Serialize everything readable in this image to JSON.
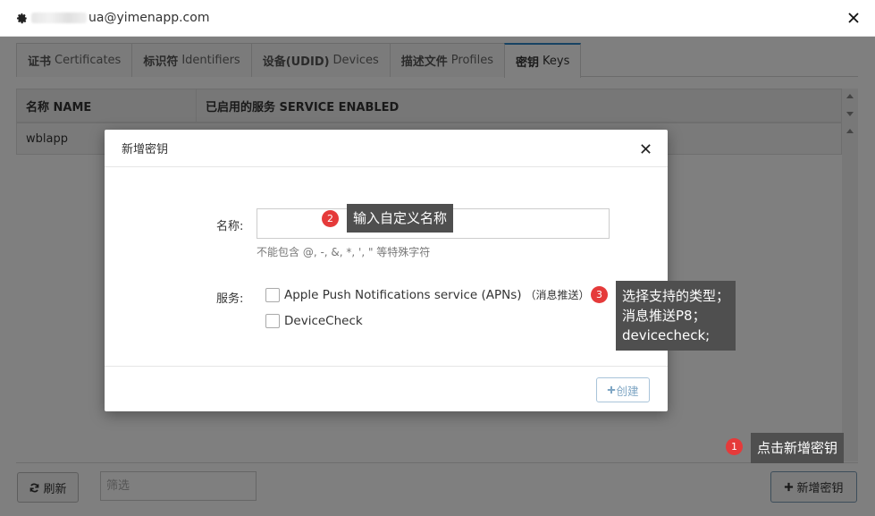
{
  "window": {
    "account": "ua@yimenapp.com"
  },
  "tabs": [
    {
      "zh": "证书",
      "en": "Certificates"
    },
    {
      "zh": "标识符",
      "en": "Identifiers"
    },
    {
      "zh": "设备(UDID)",
      "en": "Devices"
    },
    {
      "zh": "描述文件",
      "en": "Profiles"
    },
    {
      "zh": "密钥",
      "en": "Keys",
      "active": true
    }
  ],
  "table": {
    "columns": [
      "名称 NAME",
      "已启用的服务 SERVICE ENABLED"
    ],
    "rows": [
      {
        "name": "wblapp",
        "service": ""
      }
    ]
  },
  "toolbar": {
    "refresh_label": "刷新",
    "filter_placeholder": "筛选",
    "add_label": "新增密钥"
  },
  "modal": {
    "title": "新增密钥",
    "name_label": "名称:",
    "name_value": "",
    "name_hint": "不能包含 @, -, &, *, ', \" 等特殊字符",
    "service_label": "服务:",
    "services": [
      {
        "label": "Apple Push Notifications service (APNs)",
        "note": "（消息推送）",
        "checked": false
      },
      {
        "label": "DeviceCheck",
        "note": "",
        "checked": false
      }
    ],
    "create_label": "创建"
  },
  "annotations": [
    {
      "num": "1",
      "text": "点击新增密钥"
    },
    {
      "num": "2",
      "text": "输入自定义名称"
    },
    {
      "num": "3",
      "lines": [
        "选择支持的类型；",
        "消息推送P8；",
        "devicecheck;"
      ]
    }
  ],
  "colors": {
    "accent": "#2f86c6",
    "badge": "#e53a3a",
    "note_bg": "#4f4f4f",
    "create_btn": "#7fa6c4"
  }
}
